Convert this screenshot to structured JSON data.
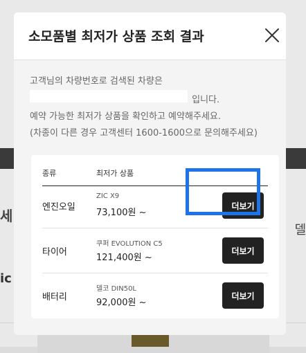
{
  "modal": {
    "title": "소모품별 최저가 상품 조회 결과",
    "intro": {
      "line1": "고객님의 차량번호로 검색된 차량은",
      "line2_suffix": "입니다.",
      "line3": "예약 가능한 최저가 상품을 확인하고 예약해주세요.",
      "line4": "(차종이 다른 경우 고객센터 1600-1600으로 문의해주세요)"
    },
    "table": {
      "headers": {
        "type": "종류",
        "price": "최저가 상품"
      },
      "rows": [
        {
          "type": "엔진오일",
          "product": "ZIC X9",
          "price": "73,100원 ~",
          "button": "더보기"
        },
        {
          "type": "타이어",
          "product": "쿠퍼 EVOLUTION C5",
          "price": "121,400원 ~",
          "button": "더보기"
        },
        {
          "type": "배터리",
          "product": "델코 DIN50L",
          "price": "92,000원 ~",
          "button": "더보기"
        }
      ]
    },
    "close_icon": "close-icon"
  },
  "background": {
    "left_text": "세",
    "right_text": "델",
    "left_logo": "ic"
  },
  "colors": {
    "highlight": "#1e73e8",
    "button_bg": "#222222",
    "modal_bg": "#f4f4f4"
  }
}
